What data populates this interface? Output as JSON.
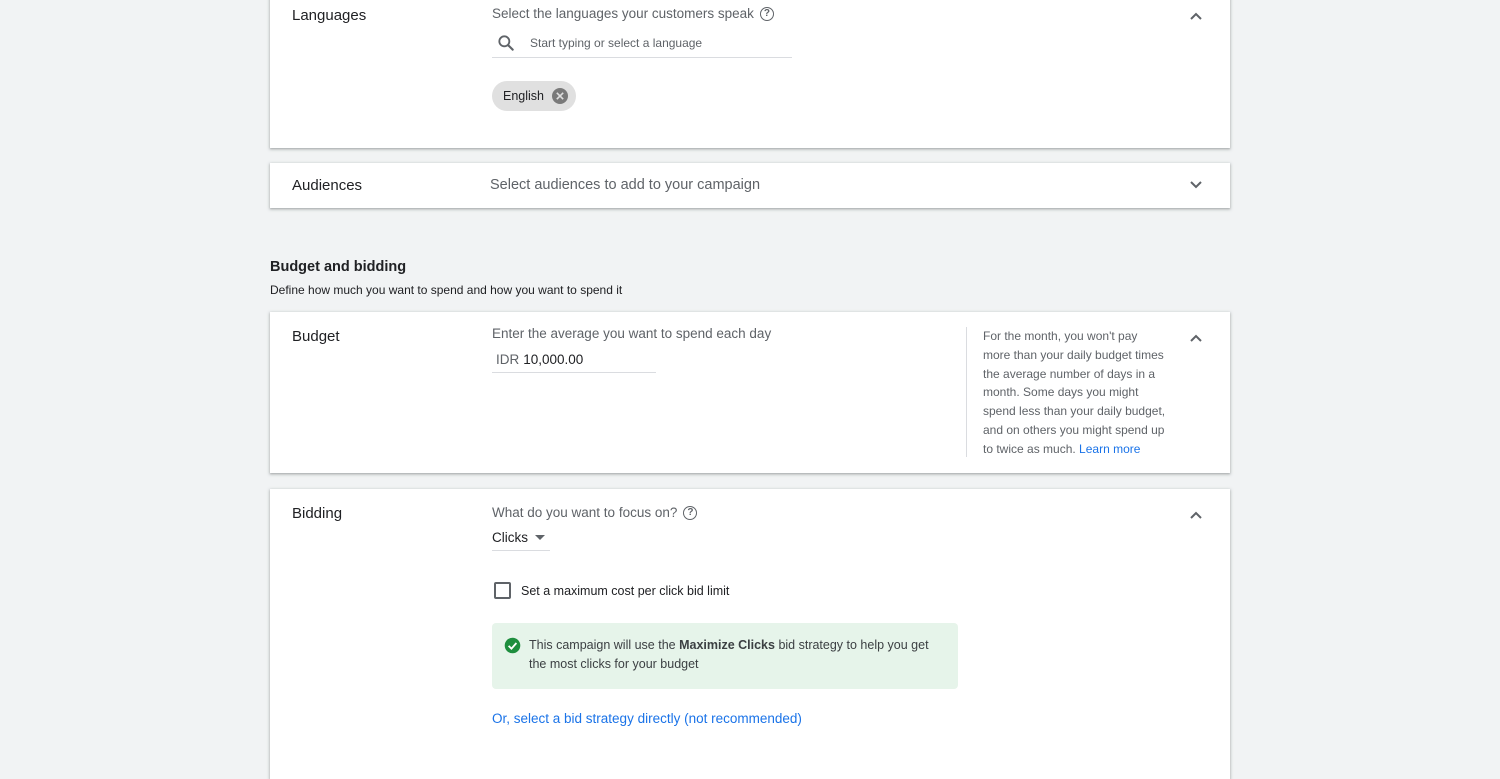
{
  "languages": {
    "label": "Languages",
    "prompt": "Select the languages your customers speak",
    "search_placeholder": "Start typing or select a language",
    "chips": [
      "English"
    ],
    "expanded": true
  },
  "audiences": {
    "label": "Audiences",
    "prompt": "Select audiences to add to your campaign",
    "expanded": false
  },
  "budget_section": {
    "title": "Budget and bidding",
    "subtitle": "Define how much you want to spend and how you want to spend it"
  },
  "budget": {
    "label": "Budget",
    "prompt": "Enter the average you want to spend each day",
    "currency": "IDR",
    "value": "10,000.00",
    "help_text": "For the month, you won't pay more than your daily budget times the average number of days in a month. Some days you might spend less than your daily budget, and on others you might spend up to twice as much.",
    "learn_more": "Learn more"
  },
  "bidding": {
    "label": "Bidding",
    "prompt": "What do you want to focus on?",
    "focus_value": "Clicks",
    "checkbox_label": "Set a maximum cost per click bid limit",
    "checkbox_checked": false,
    "info_prefix": "This campaign will use the ",
    "info_strategy": "Maximize Clicks",
    "info_suffix": " bid strategy to help you get the most clicks for your budget",
    "alt_link": "Or, select a bid strategy directly (not recommended)"
  },
  "colors": {
    "accent": "#1a73e8",
    "success": "#1e8e3e",
    "success_bg": "#e6f4ea",
    "chip_bg": "#e0e0e0"
  }
}
